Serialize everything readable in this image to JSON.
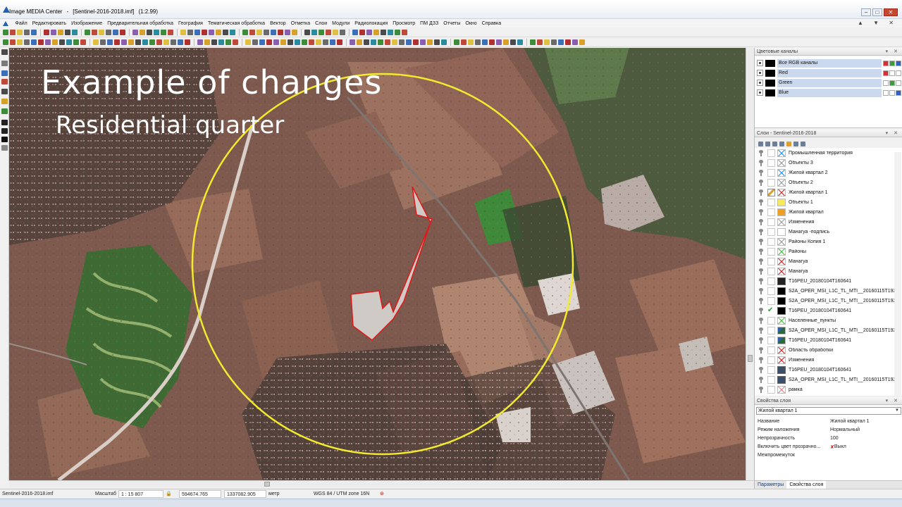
{
  "window": {
    "app_name": "Image MEDIA Center",
    "separator": "-",
    "document": "[Sentinel-2016-2018.imf]",
    "zoom": "(1:2.99)",
    "controls": [
      "–",
      "□",
      "✕"
    ]
  },
  "menu": {
    "items": [
      "Файл",
      "Редактировать",
      "Изображение",
      "Предварительная обработка",
      "География",
      "Тематическая обработка",
      "Вектор",
      "Отметка",
      "Слои",
      "Модули",
      "Радиолокация",
      "Просмотр",
      "ПМ ДЗЗ",
      "Отчеты",
      "Окно",
      "Справка"
    ],
    "right_glyphs": "▲ ▼ ✕"
  },
  "map": {
    "overlay_title": "Example of changes",
    "overlay_subtitle": "Residential quarter"
  },
  "channels_panel": {
    "title": "Цветовые каналы",
    "rows": [
      {
        "label": "Все RGB каналы"
      },
      {
        "label": "Red"
      },
      {
        "label": "Green"
      },
      {
        "label": "Blue"
      }
    ]
  },
  "layers_panel": {
    "title": "Слои - Sentinel-2016-2018",
    "layers": [
      {
        "name": "Промышленная территория",
        "icon": "vector-icon",
        "color": "#1e90ff"
      },
      {
        "name": "Объекты 3",
        "icon": "vector-icon",
        "color": "#9a9a9a"
      },
      {
        "name": "Жилой квартал 2",
        "icon": "vector-icon",
        "color": "#1e90ff"
      },
      {
        "name": "Объекты 2",
        "icon": "vector-icon",
        "color": "#9a9a9a"
      },
      {
        "name": "Жилой квартал 1",
        "icon": "vector-icon",
        "color": "#d82020",
        "editing": true
      },
      {
        "name": "Объекты 1",
        "icon": "fill-icon",
        "color": "#f5e85a"
      },
      {
        "name": "Жилой квартал",
        "icon": "fill-icon",
        "color": "#f0a020"
      },
      {
        "name": "Изменения",
        "icon": "vector-icon",
        "color": "#9a9a9a"
      },
      {
        "name": "Манагуа -подпись",
        "icon": "blank-icon",
        "color": "#ffffff"
      },
      {
        "name": "Районы Копия 1",
        "icon": "vector-icon",
        "color": "#9a9a9a"
      },
      {
        "name": "Районы",
        "icon": "vector-icon",
        "color": "#3cc23c"
      },
      {
        "name": "Манагуа",
        "icon": "vector-icon",
        "color": "#d82020"
      },
      {
        "name": "Манагуа",
        "icon": "vector-icon",
        "color": "#d82020"
      },
      {
        "name": "T16PEU_20180104T160641",
        "icon": "raster-icon",
        "color": "#222222"
      },
      {
        "name": "S2A_OPER_MSI_L1C_TL_MTI__20160115T192034",
        "icon": "raster-icon",
        "color": "#000000"
      },
      {
        "name": "S2A_OPER_MSI_L1C_TL_MTI__20160115T192034",
        "icon": "raster-icon",
        "color": "#000000"
      },
      {
        "name": "T16PEU_20180104T160641",
        "icon": "raster-icon",
        "color": "#000000",
        "checked": true
      },
      {
        "name": "Населенные_пункты",
        "icon": "vector-icon",
        "color": "#3cc23c"
      },
      {
        "name": "S2A_OPER_MSI_L1C_TL_MTI__20160115T192034",
        "icon": "map-icon",
        "color": "#2a6a3a"
      },
      {
        "name": "T16PEU_20180104T160641",
        "icon": "map-icon",
        "color": "#2a6a3a"
      },
      {
        "name": "Область обработки",
        "icon": "vector-icon",
        "color": "#d82020"
      },
      {
        "name": "Изменения",
        "icon": "vector-icon",
        "color": "#d82020"
      },
      {
        "name": "T16PEU_20180104T160641",
        "icon": "raster-icon",
        "color": "#3b4e6a"
      },
      {
        "name": "S2A_OPER_MSI_L1C_TL_MTI__20160115T192034",
        "icon": "raster-icon",
        "color": "#3b4e6a"
      },
      {
        "name": "рамка",
        "icon": "vector-icon",
        "color": "#e08080"
      }
    ]
  },
  "props_panel": {
    "title": "Свойства слоя",
    "selected_layer": "Жилой квартал 1",
    "rows": [
      {
        "key": "Название",
        "value": "Жилой квартал 1"
      },
      {
        "key": "Режим наложения",
        "value": "Нормальный"
      },
      {
        "key": "Непрозрачность",
        "value": "100"
      },
      {
        "key": "Включить цвет прозрачно...",
        "value": "Выкл"
      },
      {
        "key": "Межпромежуток",
        "value": ""
      }
    ],
    "tabs": [
      "Параметры",
      "Свойства слоя"
    ]
  },
  "status": {
    "file": "Sentinel-2016-2018.imf",
    "scale_label": "Масштаб",
    "scale": "1 : 15 807",
    "x": "594674.765",
    "y": "1337082.905",
    "unit": "метр",
    "crs": "WGS 84 / UTM zone 16N"
  },
  "colors": {
    "circle": "#f2ea2e",
    "polygon": "#e01818",
    "selection": "#cad9ee"
  }
}
